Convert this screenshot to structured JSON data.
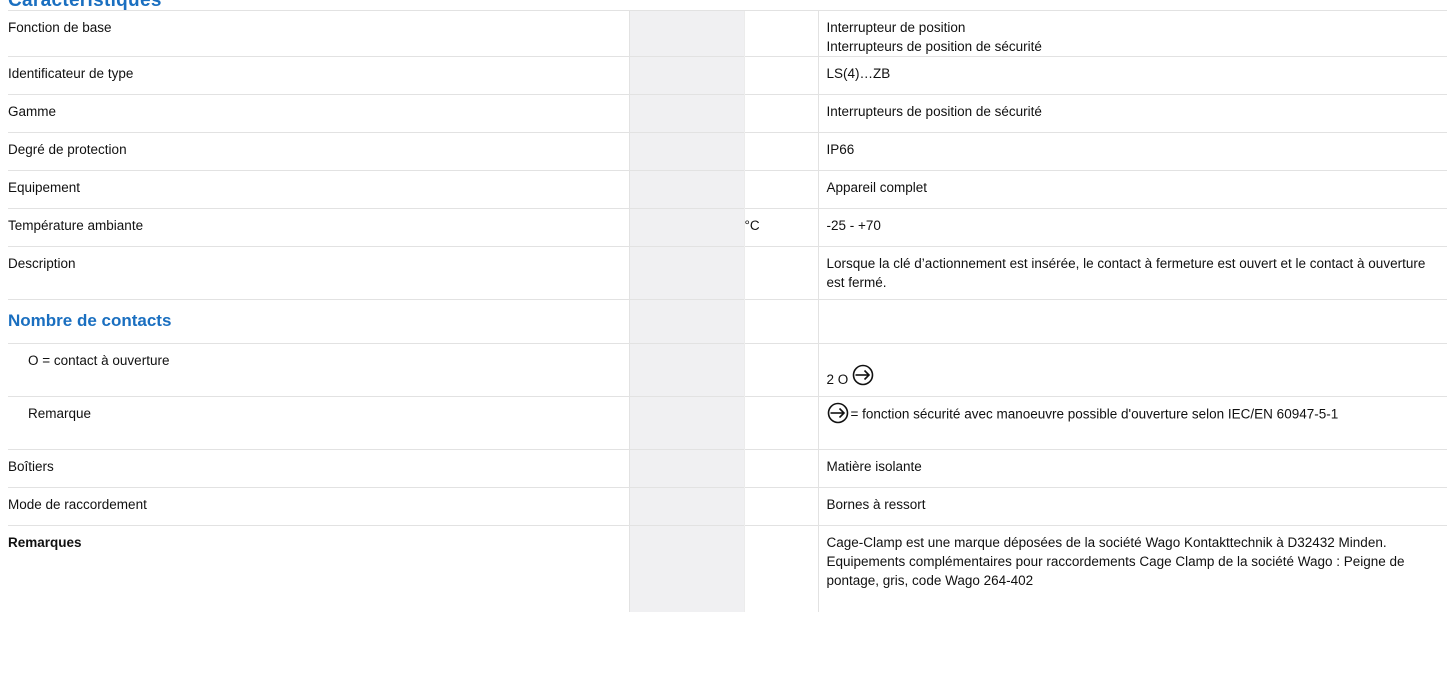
{
  "section_top": {
    "heading": "Caractéristiques"
  },
  "rows": {
    "fonction": {
      "label": "Fonction de base",
      "value_line1": "Interrupteur de position",
      "value_line2": "Interrupteurs de position de sécurité"
    },
    "type": {
      "label": "Identificateur de type",
      "value": "LS(4)…ZB"
    },
    "gamme": {
      "label": "Gamme",
      "value": "Interrupteurs de position de sécurité"
    },
    "protection": {
      "label": "Degré de protection",
      "value": "IP66"
    },
    "equipement": {
      "label": "Equipement",
      "value": "Appareil complet"
    },
    "temperature": {
      "label": "Température ambiante",
      "unit": "°C",
      "value": "-25 - +70"
    },
    "description": {
      "label": "Description",
      "value": "Lorsque la clé d’actionnement est insérée, le contact à fermeture est ouvert et le contact à ouverture est fermé."
    },
    "contacts_heading": "Nombre de contacts",
    "ouverture": {
      "label": "O = contact à ouverture",
      "value": "2 O",
      "icon": "positive-opening-icon"
    },
    "remarque": {
      "label": "Remarque",
      "value": "= fonction sécurité avec manoeuvre possible d'ouverture selon IEC/EN 60947-5-1",
      "icon": "positive-opening-icon"
    },
    "boitiers": {
      "label": "Boîtiers",
      "value": "Matière isolante"
    },
    "raccordement": {
      "label": "Mode de raccordement",
      "value": "Bornes à ressort"
    },
    "remarques": {
      "label": "Remarques",
      "value_line1": "Cage-Clamp est une marque déposées de la société Wago Kontakttechnik à D32432 Minden.",
      "value_line2": "Equipements complémentaires pour raccordements Cage Clamp de la société Wago : Peigne de pontage, gris, code Wago 264-402"
    }
  },
  "colors": {
    "heading": "#1a6fc0",
    "gray_column": "#f0f0f2",
    "border": "#e2e2e2"
  }
}
